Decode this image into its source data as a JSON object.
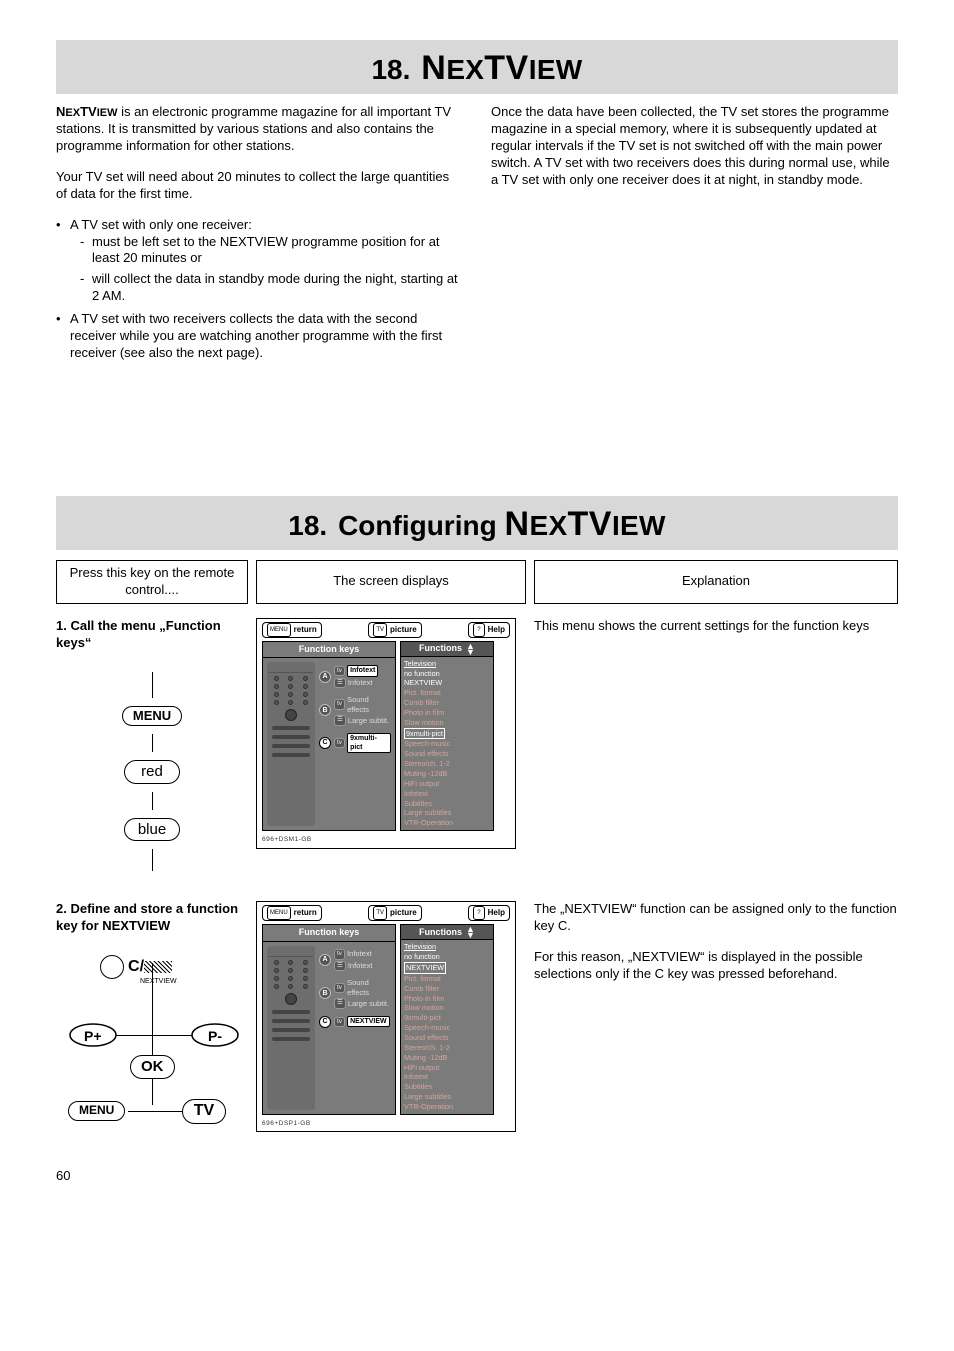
{
  "page_number": "60",
  "title1": {
    "num": "18.",
    "big": "N",
    "restA": "EX",
    "bigB": "TV",
    "restB": "IEW"
  },
  "intro": {
    "p1_a": "N",
    "p1_a_sc": "EX",
    "p1_b": "TV",
    "p1_b_sc": "IEW",
    "p1_rest": " is an electronic programme magazine for all important TV stations. It is transmitted by various stations and also contains the programme information for other stations.",
    "p2": "Your TV set will need about 20 minutes to collect the large quantities of data for the first time.",
    "b1_title": "A TV set with only one receiver:",
    "b1_d1_a": "must be left set to the ",
    "b1_d1_sc": "NEXTVIEW",
    "b1_d1_b": " programme position for at least 20 minutes or",
    "b1_d2": "will collect the data in standby mode during the night, starting at 2 AM.",
    "b2": "A TV set with two receivers collects the data with the second receiver while you are watching another programme with the first receiver (see also the next page).",
    "right_p": "Once the data have been collected, the TV set stores the programme magazine in a special memory, where it is subsequently updated at regular intervals if the TV set is not switched off with the main power switch. A TV set with two receivers does this during normal use, while a TV set with only one receiver does it at night, in standby mode."
  },
  "title2": {
    "num": "18.",
    "text": "Configuring ",
    "big": "N",
    "restA": "EX",
    "bigB": "TV",
    "restB": "IEW"
  },
  "headers": {
    "col1": "Press this key on the remote control....",
    "col2": "The screen displays",
    "col3": "Explanation"
  },
  "step1": {
    "title": "1. Call the menu „Function keys“",
    "keys": {
      "menu": "MENU",
      "red": "red",
      "blue": "blue"
    },
    "expl": "This menu shows the current settings for the function keys"
  },
  "step2": {
    "title": "2. Define and store a function key for NEXTVIEW",
    "labels": {
      "c": "C",
      "nextview": "NEXTVIEW",
      "pplus": "P+",
      "pminus": "P-",
      "ok": "OK",
      "menu": "MENU",
      "tv": "TV"
    },
    "expl_p1": "The „NEXTVIEW“ function can be assigned only to the function key C.",
    "expl_p2": "For this reason, „NEXTVIEW“ is displayed in the possible selections only if the C key was pressed beforehand."
  },
  "tv_common": {
    "head_return": "return",
    "head_return_key": "MENU",
    "head_pic": "picture",
    "head_pic_key": "TV",
    "head_help": "Help",
    "head_help_key": "?",
    "left_title": "Function keys",
    "right_title": "Functions",
    "footcode": "696+DSM1-GB",
    "footcode2": "696+DSP1-GB",
    "rowA_top": "Infotext",
    "rowA_bot": "Infotext",
    "rowB_top": "Sound effects",
    "rowB_bot": "Large subtit.",
    "rowC_top_1": "9xmulti-pict",
    "rowC_top_2": "NEXTVIEW"
  },
  "tv1_functions": [
    {
      "t": "Television",
      "cls": "hl under"
    },
    {
      "t": "no function",
      "cls": "hl"
    },
    {
      "t": "NEXTVIEW",
      "cls": "hl"
    },
    {
      "t": "Pict. format",
      "cls": ""
    },
    {
      "t": "Comb filter",
      "cls": ""
    },
    {
      "t": "Photo in film",
      "cls": ""
    },
    {
      "t": "Slow motion",
      "cls": ""
    },
    {
      "t": "9xmulti-pict",
      "cls": "selbox"
    },
    {
      "t": "Speech-music",
      "cls": ""
    },
    {
      "t": "Sound effects",
      "cls": ""
    },
    {
      "t": "Stereo/ch. 1-2",
      "cls": ""
    },
    {
      "t": "Muting -12dB",
      "cls": ""
    },
    {
      "t": "HiFi output",
      "cls": ""
    },
    {
      "t": "Infotext",
      "cls": ""
    },
    {
      "t": "Subtitles",
      "cls": ""
    },
    {
      "t": "Large subtitles",
      "cls": ""
    },
    {
      "t": "VTR-Operation",
      "cls": ""
    }
  ],
  "tv2_functions": [
    {
      "t": "Television",
      "cls": "hl under"
    },
    {
      "t": "no function",
      "cls": "hl"
    },
    {
      "t": "NEXTVIEW",
      "cls": "selbox"
    },
    {
      "t": "Pict. format",
      "cls": ""
    },
    {
      "t": "Comb filter",
      "cls": ""
    },
    {
      "t": "Photo in film",
      "cls": ""
    },
    {
      "t": "Slow motion",
      "cls": ""
    },
    {
      "t": "9xmulti-pict",
      "cls": ""
    },
    {
      "t": "Speech-music",
      "cls": ""
    },
    {
      "t": "Sound effects",
      "cls": ""
    },
    {
      "t": "Stereo/ch. 1-2",
      "cls": ""
    },
    {
      "t": "Muting -12dB",
      "cls": ""
    },
    {
      "t": "HiFi output",
      "cls": ""
    },
    {
      "t": "Infotext",
      "cls": ""
    },
    {
      "t": "Subtitles",
      "cls": ""
    },
    {
      "t": "Large subtitles",
      "cls": ""
    },
    {
      "t": "VTR-Operation",
      "cls": ""
    }
  ]
}
